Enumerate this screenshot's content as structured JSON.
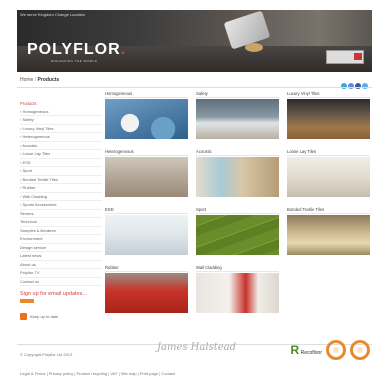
{
  "header": {
    "topline": "We serve Kingdom  Change Location",
    "logo": "POLYFLOR",
    "logo_mark": ".",
    "tagline": "ENHANCING THE WORLD"
  },
  "breadcrumb": {
    "home": "Home",
    "separator": "/",
    "current": "Products"
  },
  "social": {
    "icons": [
      "rss-icon",
      "email-icon",
      "facebook-icon",
      "twitter-icon"
    ],
    "colors": [
      "#3ea3d6",
      "#5a8fd8",
      "#3b5998",
      "#55acee"
    ]
  },
  "sidebar": {
    "heading": "Products",
    "items": [
      {
        "label": "Homogeneous",
        "sub": true
      },
      {
        "label": "Safety",
        "sub": true
      },
      {
        "label": "Luxury Vinyl Tiles",
        "sub": true
      },
      {
        "label": "Heterogeneous",
        "sub": true
      },
      {
        "label": "Acoustic",
        "sub": true
      },
      {
        "label": "Loose Lay Tiles",
        "sub": true
      },
      {
        "label": "ESD",
        "sub": true
      },
      {
        "label": "Sport",
        "sub": true
      },
      {
        "label": "Bonded Textile Tiles",
        "sub": true
      },
      {
        "label": "Rubber",
        "sub": true
      },
      {
        "label": "Wall Cladding",
        "sub": true
      },
      {
        "label": "Sports Accessories",
        "sub": true
      },
      {
        "label": "Sectors",
        "sub": false
      },
      {
        "label": "Technical",
        "sub": false
      },
      {
        "label": "Samples & literature",
        "sub": false
      },
      {
        "label": "Environment",
        "sub": false
      },
      {
        "label": "Design service",
        "sub": false
      },
      {
        "label": "Latest news",
        "sub": false
      },
      {
        "label": "About us",
        "sub": false
      },
      {
        "label": "Polyflor TV",
        "sub": false
      },
      {
        "label": "Contact us",
        "sub": false
      }
    ],
    "signup": "Sign up for email updates...",
    "keep": "Keep up to date"
  },
  "products": [
    {
      "label": "Homogeneous",
      "bg": "radial-gradient(circle at 30% 60%,#f2f2f2 0 14%,transparent 15%),radial-gradient(circle at 70% 75%,#6aa0c8 0 18%,transparent 19%),linear-gradient(160deg,#6f9fc6,#2f5f8c)"
    },
    {
      "label": "Safety",
      "bg": "linear-gradient(180deg,#5f6e7a 0%,#8a9aa5 45%,#e0e4e6 60%,#b7b0a4 100%)"
    },
    {
      "label": "Luxury Vinyl Tiles",
      "bg": "linear-gradient(180deg,#2c2a2a 0%,#6a5a4a 40%,#a07848 70%,#8a6238 100%)"
    },
    {
      "label": "Heterogeneous",
      "bg": "linear-gradient(180deg,#cfc7bb 0%,#b8ad9f 40%,#9a8a78 100%)"
    },
    {
      "label": "Acoustic",
      "bg": "linear-gradient(90deg,#e4dccd 0%,#a6ccd6 30%,#d8c7a8 55%,#b59c76 100%)"
    },
    {
      "label": "Loose Lay Tiles",
      "bg": "linear-gradient(180deg,#f1ede6 0%,#e2dbcf 50%,#c9beae 100%)"
    },
    {
      "label": "ESD",
      "bg": "linear-gradient(180deg,#eef2f4 0%,#dfe6ea 50%,#c4ced4 100%)"
    },
    {
      "label": "Sport",
      "bg": "repeating-linear-gradient(160deg,#6a8c2a 0 10px,#7fa035 10px 11px,#5e7f24 11px 20px)"
    },
    {
      "label": "Bonded Textile Tiles",
      "bg": "linear-gradient(180deg,#8a7a5c 0%,#c8b48c 40%,#e8d9b0 70%,#9c8a64 100%)"
    },
    {
      "label": "Rubber",
      "bg": "linear-gradient(180deg,#9a8c84 0%,#c8332a 45%,#a82418 100%)"
    },
    {
      "label": "Wall Cladding",
      "bg": "linear-gradient(90deg,#e9e6e1 0%,#f4f1ec 40%,#c8322a 60%,#f0eee9 75%,#dcd6ce 100%)"
    }
  ],
  "footer": {
    "copyright": "© Copyright Polyflor Ltd 2013",
    "signature": "James Halstead",
    "links": "Legal & Terms  |  Privacy policy  |  Product recycling  |  VAT  |  Site map  |  Print page  |  Contact",
    "recofloor": "Recofloor",
    "recofloor_mark": "R"
  }
}
